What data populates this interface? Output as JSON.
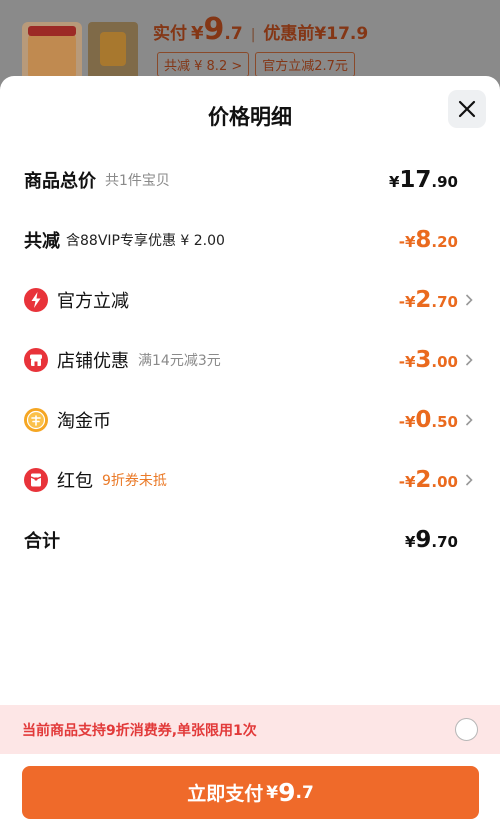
{
  "header": {
    "price_label": "实付",
    "currency": "¥",
    "price_int": "9",
    "price_dec": ".7",
    "separator": "|",
    "pre_price": "优惠前¥17.9",
    "tags": [
      {
        "label": "共减 ¥ 8.2 >"
      },
      {
        "label": "官方立减2.7元"
      }
    ]
  },
  "sheet": {
    "title": "价格明细",
    "close_icon": "close-icon"
  },
  "rows": {
    "total": {
      "label": "商品总价",
      "sub": "共1件宝贝",
      "currency": "¥",
      "int": "17",
      "dec": ".90"
    },
    "discount": {
      "label": "共减",
      "sub": "含88VIP专享优惠 ¥ 2.00",
      "currency": "-¥",
      "int": "8",
      "dec": ".20"
    },
    "official": {
      "label": "官方立减",
      "sub": "",
      "currency": "-¥",
      "int": "2",
      "dec": ".70",
      "icon": "lightning-icon"
    },
    "store": {
      "label": "店铺优惠",
      "sub": "满14元减3元",
      "currency": "-¥",
      "int": "3",
      "dec": ".00",
      "icon": "store-icon"
    },
    "coins": {
      "label": "淘金币",
      "sub": "",
      "currency": "-¥",
      "int": "0",
      "dec": ".50",
      "icon": "coin-icon"
    },
    "redpacket": {
      "label": "红包",
      "sub": "9折券未抵",
      "currency": "-¥",
      "int": "2",
      "dec": ".00",
      "icon": "red-packet-icon"
    },
    "sum": {
      "label": "合计",
      "currency": "¥",
      "int": "9",
      "dec": ".70"
    }
  },
  "notice": {
    "text": "当前商品支持9折消费券,单张限用1次",
    "checked": false
  },
  "pay_button": {
    "label": "立即支付",
    "currency": "¥",
    "int": "9",
    "dec": ".7"
  },
  "colors": {
    "accent_orange": "#ef6a2a",
    "discount_orange": "#ea6a1e",
    "notice_bg": "#fde6e6",
    "notice_text": "#e23a3a"
  }
}
